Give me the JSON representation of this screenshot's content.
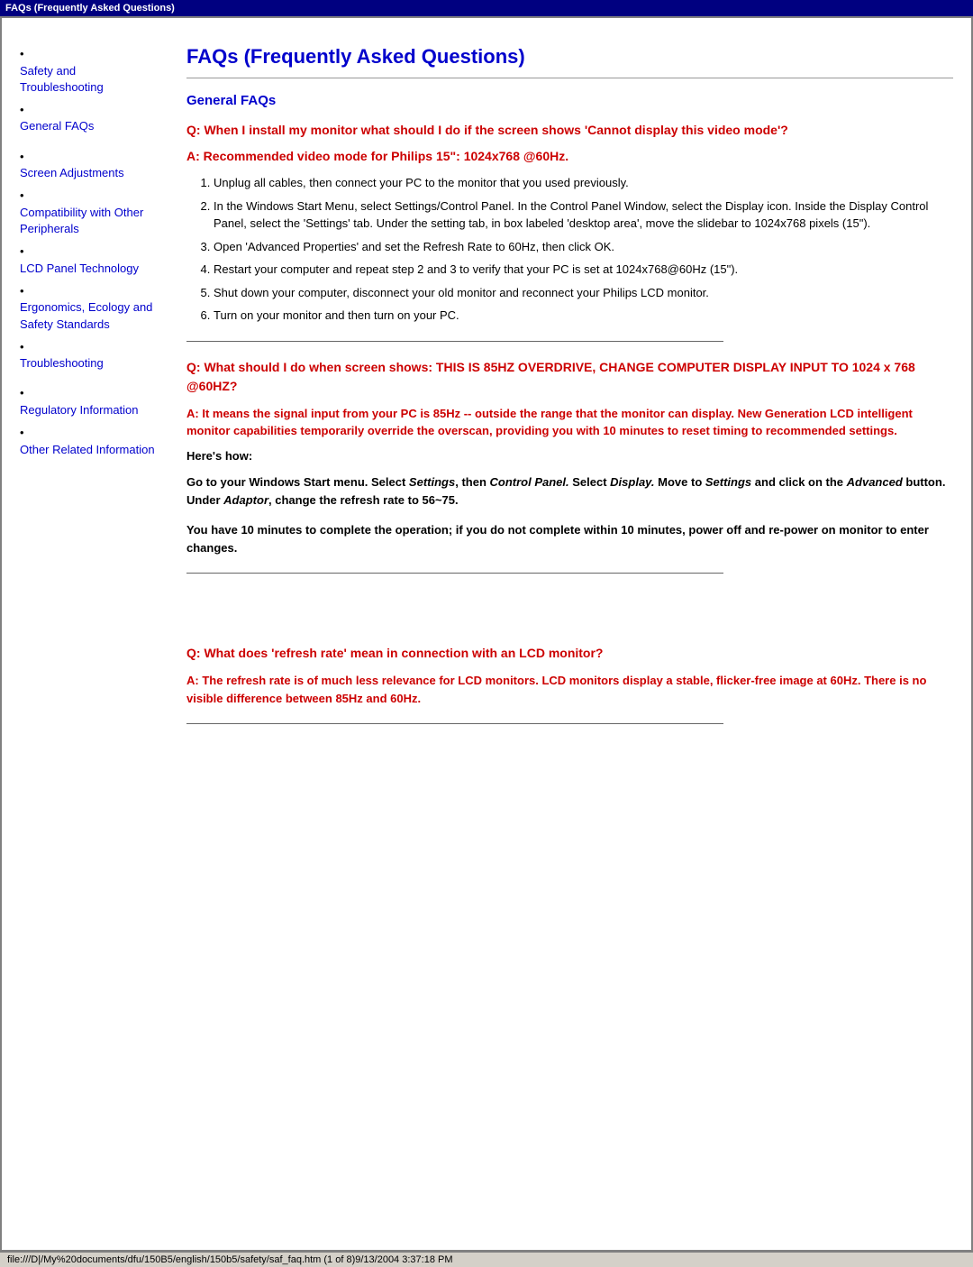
{
  "titlebar": {
    "label": "FAQs (Frequently Asked Questions)"
  },
  "statusbar": {
    "text": "file:///D|/My%20documents/dfu/150B5/english/150b5/safety/saf_faq.htm (1 of 8)9/13/2004 3:37:18 PM"
  },
  "sidebar": {
    "items": [
      {
        "id": "safety",
        "label": "Safety and Troubleshooting"
      },
      {
        "id": "general-faqs",
        "label": "General FAQs"
      },
      {
        "id": "screen",
        "label": "Screen Adjustments"
      },
      {
        "id": "compatibility",
        "label": "Compatibility with Other Peripherals"
      },
      {
        "id": "lcd",
        "label": "LCD Panel Technology"
      },
      {
        "id": "ergonomics",
        "label": "Ergonomics, Ecology and Safety Standards"
      },
      {
        "id": "troubleshooting",
        "label": "Troubleshooting"
      },
      {
        "id": "regulatory",
        "label": "Regulatory Information"
      },
      {
        "id": "other",
        "label": "Other Related Information"
      }
    ]
  },
  "main": {
    "page_title": "FAQs (Frequently Asked Questions)",
    "section_title": "General FAQs",
    "q1": {
      "question": "Q: When I install my monitor what should I do if the screen shows 'Cannot display this video mode'?",
      "answer_label": "A:",
      "answer_text": "Recommended video mode for Philips 15\": 1024x768 @60Hz.",
      "steps": [
        "Unplug all cables, then connect your PC to the monitor that you used previously.",
        "In the Windows Start Menu, select Settings/Control Panel. In the Control Panel Window, select the Display icon. Inside the Display Control Panel, select the 'Settings' tab. Under the setting tab, in box labeled 'desktop area', move the slidebar to 1024x768 pixels (15\").",
        "Open 'Advanced Properties' and set the Refresh Rate to 60Hz, then click OK.",
        "Restart your computer and repeat step 2 and 3 to verify that your PC is set at 1024x768@60Hz (15\").",
        "Shut down your computer, disconnect your old monitor and reconnect your Philips LCD monitor.",
        "Turn on your monitor and then turn on your PC."
      ]
    },
    "q2": {
      "question": "Q: What should I do when screen shows: THIS IS 85HZ OVERDRIVE, CHANGE COMPUTER DISPLAY INPUT TO 1024 x 768 @60HZ?",
      "answer_label": "A:",
      "answer_text": "It means the signal input from your PC is 85Hz -- outside the range that the monitor can display. New Generation LCD intelligent monitor capabilities temporarily override the overscan, providing you with 10 minutes to reset timing to recommended settings.",
      "heres_how": "Here's how:",
      "go_to_text_parts": [
        "Go to your Windows Start menu. Select ",
        "Settings",
        ", then ",
        "Control Panel.",
        " Select ",
        "Display.",
        " Move to ",
        "Settings",
        " and click on the ",
        "Advanced",
        " button. Under ",
        "Adaptor",
        ", change the refresh rate to 56~75."
      ],
      "ten_min": "You have 10 minutes to complete the operation; if you do not complete within 10 minutes, power off and re-power on monitor to enter changes."
    },
    "q3": {
      "question": "Q: What does 'refresh rate' mean in connection with an LCD monitor?",
      "answer_label": "A:",
      "answer_text": "The refresh rate is of much less relevance for LCD monitors. LCD monitors display a stable, flicker-free image at 60Hz. There is no visible difference between 85Hz and 60Hz."
    }
  }
}
